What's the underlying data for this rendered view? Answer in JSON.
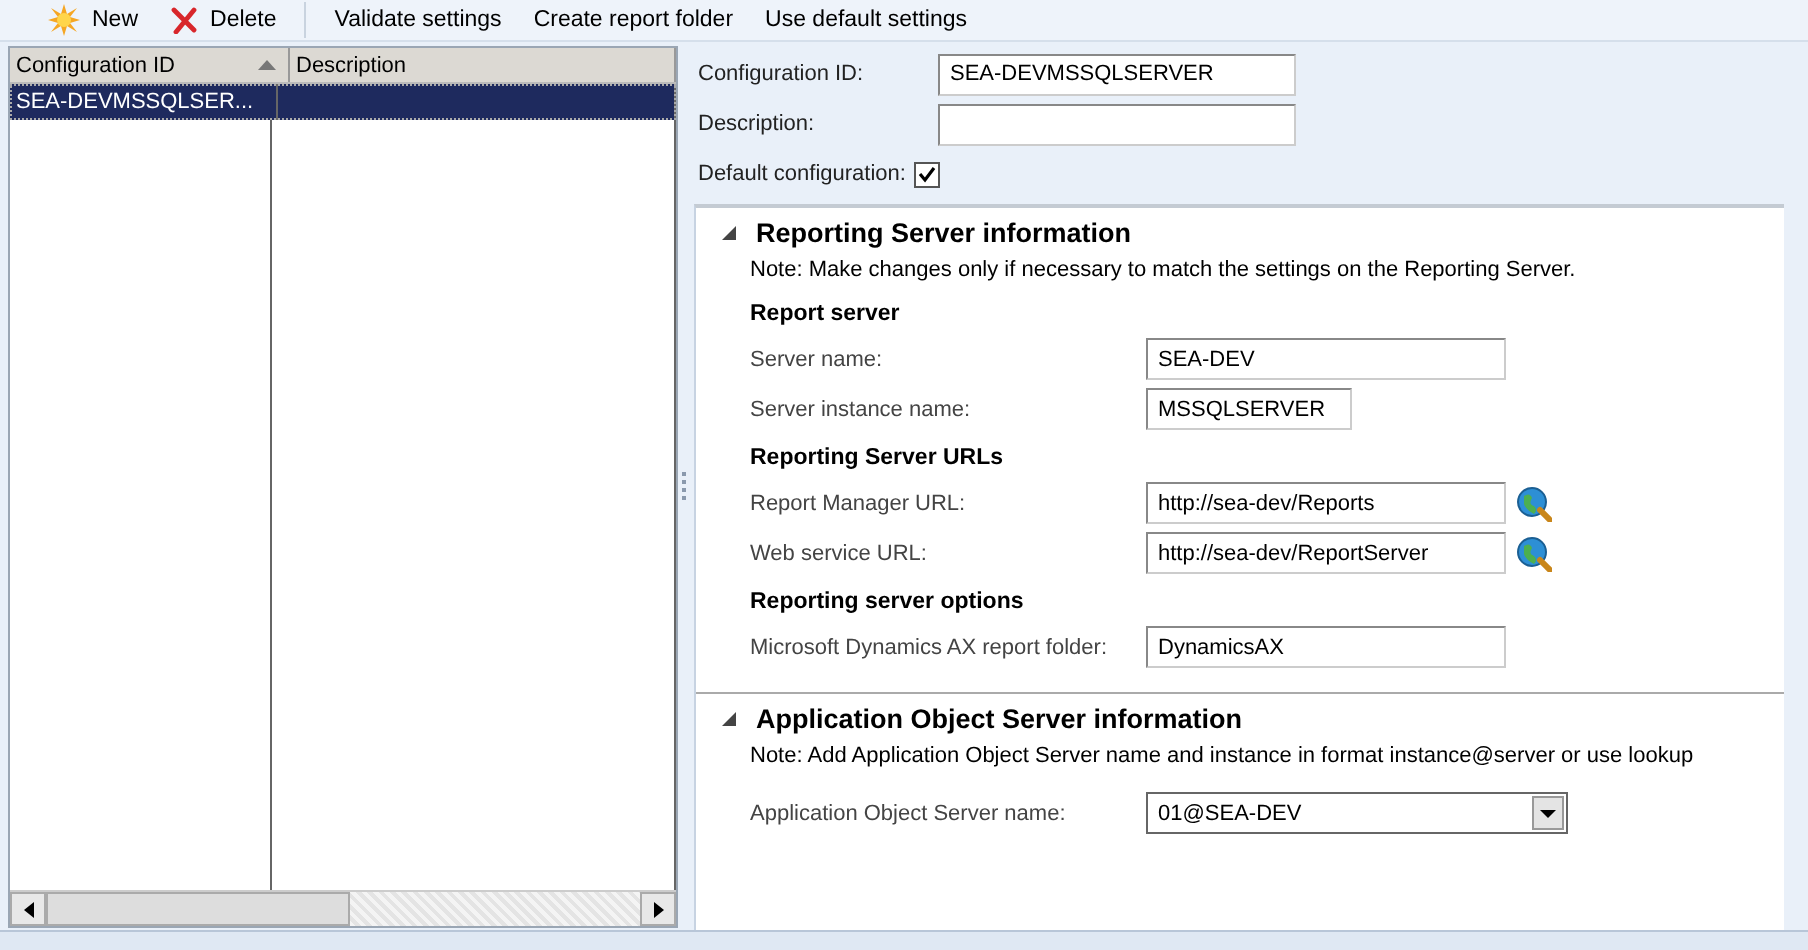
{
  "toolbar": [
    {
      "label": "New",
      "kind": "new"
    },
    {
      "label": "Delete",
      "kind": "delete"
    },
    {
      "label": "Validate settings",
      "kind": "plain"
    },
    {
      "label": "Create report folder",
      "kind": "plain"
    },
    {
      "label": "Use default settings",
      "kind": "plain"
    }
  ],
  "grid": {
    "columns": [
      {
        "label": "Configuration ID",
        "sorted": true
      },
      {
        "label": "Description",
        "sorted": false
      }
    ],
    "rows": [
      {
        "cells": [
          "SEA-DEVMSSQLSER...",
          ""
        ],
        "selected": true
      }
    ]
  },
  "header_fields": [
    {
      "label": "Configuration ID:",
      "kind": "text",
      "value": "SEA-DEVMSSQLSERVER"
    },
    {
      "label": "Description:",
      "kind": "text"
    },
    {
      "label": "Default configuration:",
      "kind": "checkbox",
      "checked": true
    }
  ],
  "sections": [
    {
      "title": "Reporting Server information",
      "expanded": true,
      "note": "Note: Make changes only if necessary to match the settings on the Reporting Server.",
      "groups": [
        {
          "title": "Report server",
          "fields": [
            {
              "label": "Server name:",
              "kind": "text",
              "value": "SEA-DEV"
            },
            {
              "label": "Server instance name:",
              "kind": "short",
              "value": "MSSQLSERVER"
            }
          ]
        },
        {
          "title": "Reporting Server URLs",
          "fields": [
            {
              "label": "Report Manager URL:",
              "kind": "lookup",
              "value": "http://sea-dev/Reports"
            },
            {
              "label": "Web service URL:",
              "kind": "lookup",
              "value": "http://sea-dev/ReportServer"
            }
          ]
        },
        {
          "title": "Reporting server options",
          "fields": [
            {
              "label": "Microsoft Dynamics AX report folder:",
              "kind": "text",
              "value": "DynamicsAX"
            }
          ]
        }
      ]
    },
    {
      "title": "Application Object Server information",
      "expanded": true,
      "note": "Note: Add Application Object Server name and instance in format instance@server or use lookup",
      "groups": [
        {
          "fields": [
            {
              "label": "Application Object Server name:",
              "kind": "combo",
              "value": "01@SEA-DEV"
            }
          ]
        }
      ]
    }
  ]
}
